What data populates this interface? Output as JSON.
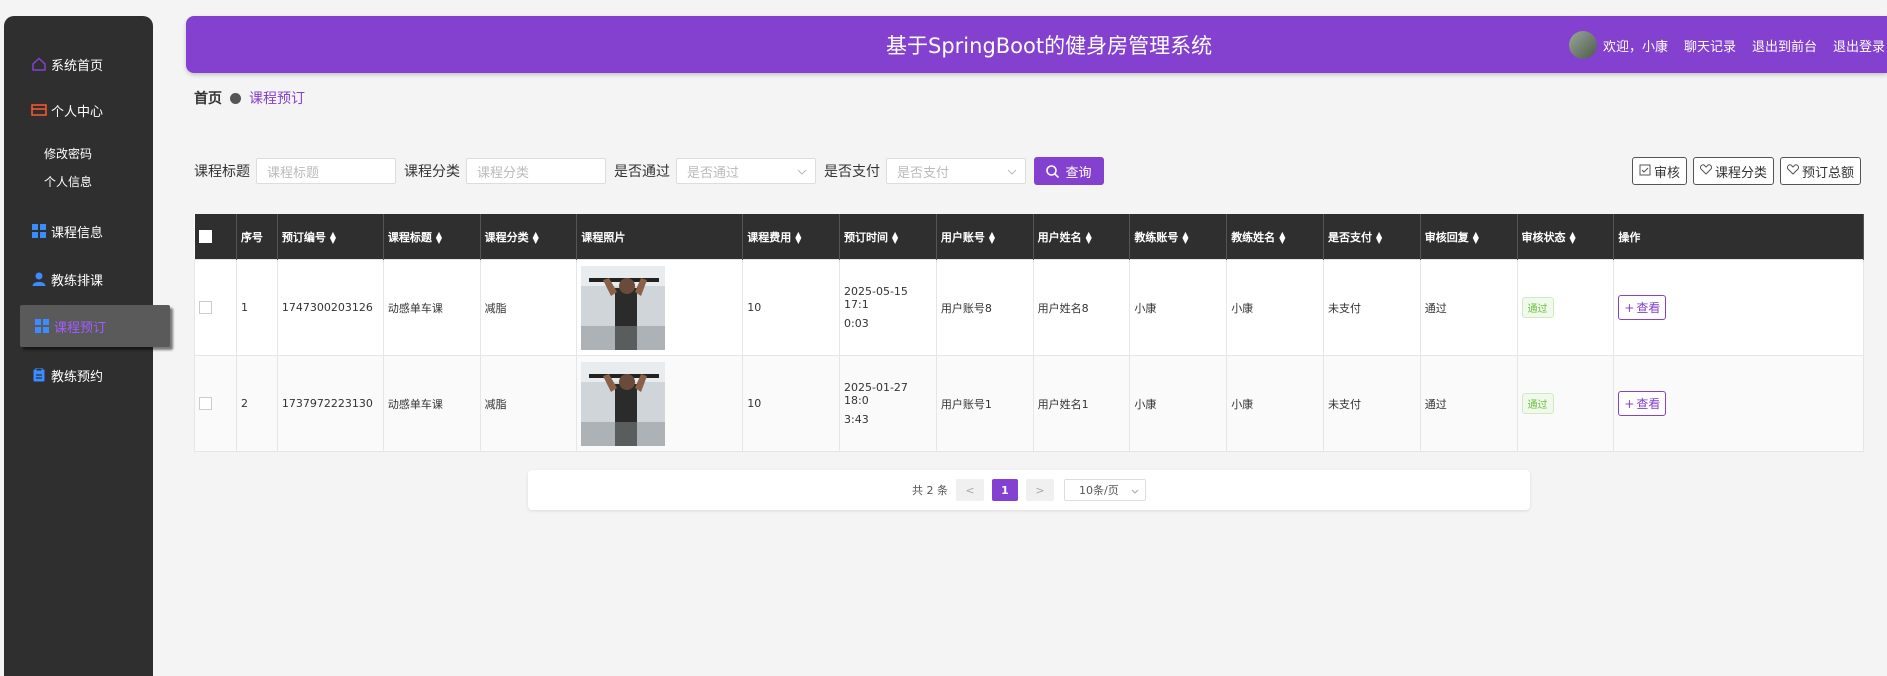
{
  "header": {
    "title": "基于SpringBoot的健身房管理系统",
    "welcome": "欢迎，小康",
    "links": [
      "聊天记录",
      "退出到前台",
      "退出登录"
    ]
  },
  "sidebar": {
    "items": [
      {
        "label": "系统首页",
        "icon": "home-icon"
      },
      {
        "label": "个人中心",
        "icon": "wallet-icon"
      },
      {
        "label": "修改密码"
      },
      {
        "label": "个人信息"
      },
      {
        "label": "课程信息",
        "icon": "grid-icon"
      },
      {
        "label": "教练排课",
        "icon": "user-icon"
      },
      {
        "label": "课程预订",
        "icon": "grid-icon"
      },
      {
        "label": "教练预约",
        "icon": "clipboard-icon"
      }
    ],
    "active_index": 6
  },
  "breadcrumb": {
    "home": "首页",
    "current": "课程预订"
  },
  "search": {
    "fields": [
      {
        "label": "课程标题",
        "placeholder": "课程标题"
      },
      {
        "label": "课程分类",
        "placeholder": "课程分类"
      },
      {
        "label": "是否通过",
        "placeholder": "是否通过"
      },
      {
        "label": "是否支付",
        "placeholder": "是否支付"
      }
    ],
    "query_label": "查询"
  },
  "actions": [
    "审核",
    "课程分类",
    "预订总额"
  ],
  "table": {
    "headers": [
      "序号",
      "预订编号",
      "课程标题",
      "课程分类",
      "课程照片",
      "课程费用",
      "预订时间",
      "用户账号",
      "用户姓名",
      "教练账号",
      "教练姓名",
      "是否支付",
      "审核回复",
      "审核状态",
      "操作"
    ],
    "rows": [
      {
        "index": "1",
        "booking_no": "1747300203126",
        "course_title": "动感单车课",
        "category": "减脂",
        "fee": "10",
        "time_line1": "2025-05-15 17:1",
        "time_line2": "0:03",
        "user_account": "用户账号8",
        "user_name": "用户姓名8",
        "coach_account": "小康",
        "coach_name": "小康",
        "paid": "未支付",
        "reply": "通过",
        "status": "通过",
        "action": "查看"
      },
      {
        "index": "2",
        "booking_no": "1737972223130",
        "course_title": "动感单车课",
        "category": "减脂",
        "fee": "10",
        "time_line1": "2025-01-27 18:0",
        "time_line2": "3:43",
        "user_account": "用户账号1",
        "user_name": "用户姓名1",
        "coach_account": "小康",
        "coach_name": "小康",
        "paid": "未支付",
        "reply": "通过",
        "status": "通过",
        "action": "查看"
      }
    ]
  },
  "pagination": {
    "total_text": "共 2 条",
    "prev": "<",
    "current": "1",
    "next": ">",
    "page_size": "10条/页"
  },
  "colors": {
    "accent": "#8440cf",
    "sidebar_bg": "#2f2f2f",
    "success": "#67c23a"
  }
}
